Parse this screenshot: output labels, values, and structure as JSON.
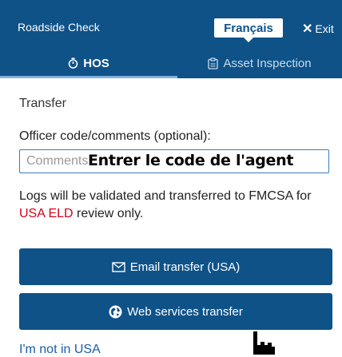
{
  "header": {
    "title": "Roadside Check",
    "language_button": "Français",
    "exit_label": "Exit",
    "exit_icon": "x-icon"
  },
  "tabs": [
    {
      "label": "HOS",
      "icon": "stopwatch-icon",
      "active": true
    },
    {
      "label": "Asset Inspection",
      "icon": "clipboard-icon",
      "active": false
    }
  ],
  "transfer": {
    "section_title": "Transfer",
    "field_label": "Officer code/comments (optional):",
    "input_placeholder": "Comments",
    "input_hint_overlay": "Entrer le code de l'agent",
    "info_text_before": "Logs will be validated and transferred to FMCSA for ",
    "info_highlight": "USA ELD",
    "info_text_after": " review only.",
    "email_button": "Email transfer (USA)",
    "web_button": "Web services transfer",
    "not_in_usa_link": "I'm not in USA"
  },
  "colors": {
    "header_bg": "#0e5288",
    "button_bg": "#0e5288",
    "highlight_red": "#d0021b",
    "link_blue": "#1a5ea8"
  }
}
